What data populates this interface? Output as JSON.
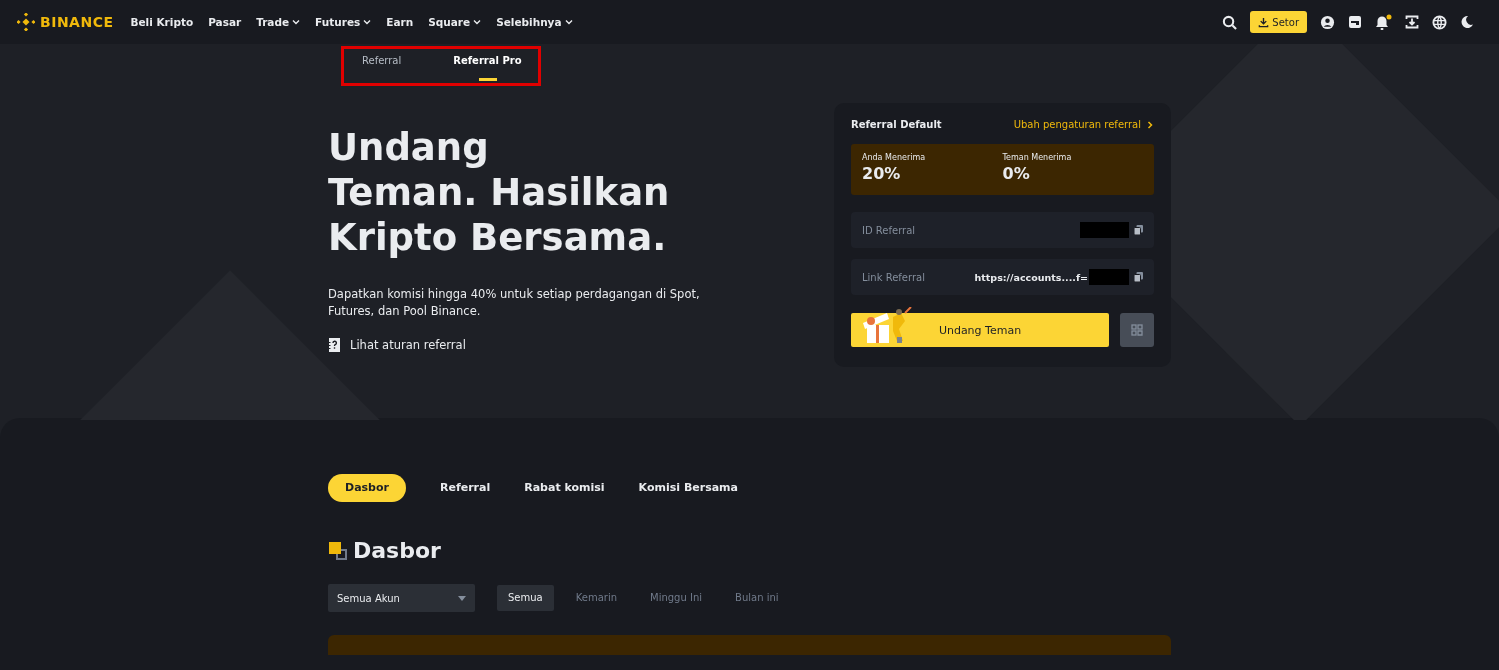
{
  "nav": {
    "logo": "BINANCE",
    "items": [
      {
        "label": "Beli Kripto",
        "has_menu": false
      },
      {
        "label": "Pasar",
        "has_menu": false
      },
      {
        "label": "Trade",
        "has_menu": true
      },
      {
        "label": "Futures",
        "has_menu": true
      },
      {
        "label": "Earn",
        "has_menu": false
      },
      {
        "label": "Square",
        "has_menu": true
      },
      {
        "label": "Selebihnya",
        "has_menu": true
      }
    ],
    "deposit_button": "Setor",
    "has_notification": true
  },
  "top_tabs": [
    {
      "label": "Referral",
      "selected": false
    },
    {
      "label": "Referral Pro",
      "selected": true
    }
  ],
  "hero": {
    "title_lines": [
      "Undang",
      "Teman. Hasilkan",
      "Kripto Bersama."
    ],
    "description": "Dapatkan komisi hingga 40% untuk setiap perdagangan di Spot, Futures, dan Pool Binance.",
    "rules_link": "Lihat aturan referral"
  },
  "card": {
    "title": "Referral Default",
    "settings_link": "Ubah pengaturan referral",
    "rates": [
      {
        "label": "Anda Menerima",
        "value": "20%"
      },
      {
        "label": "Teman Menerima",
        "value": "0%"
      }
    ],
    "fields": [
      {
        "label": "ID Referral"
      },
      {
        "label": "Link Referral",
        "value": "https://accounts....f="
      }
    ],
    "invite_button": "Undang Teman"
  },
  "section_tabs": [
    {
      "label": "Dasbor",
      "selected": true
    },
    {
      "label": "Referral",
      "selected": false
    },
    {
      "label": "Rabat komisi",
      "selected": false
    },
    {
      "label": "Komisi Bersama",
      "selected": false
    }
  ],
  "dashboard": {
    "title": "Dasbor",
    "account_select": "Semua Akun",
    "periods": [
      {
        "label": "Semua",
        "selected": true
      },
      {
        "label": "Kemarin",
        "selected": false
      },
      {
        "label": "Minggu Ini",
        "selected": false
      },
      {
        "label": "Bulan ini",
        "selected": false
      }
    ]
  }
}
